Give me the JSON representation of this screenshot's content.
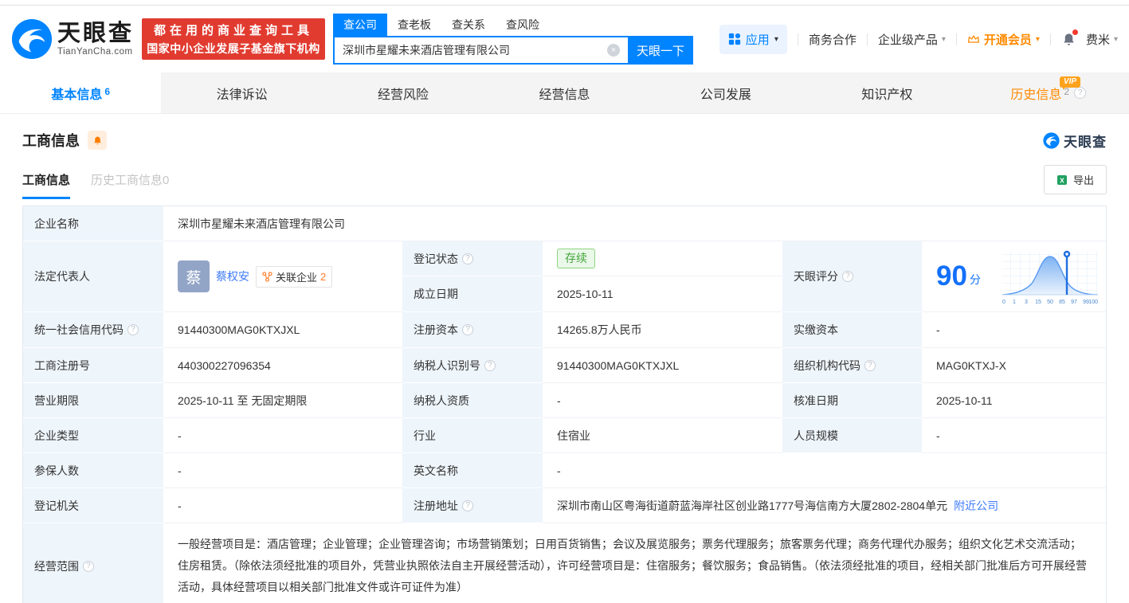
{
  "colors": {
    "brand_blue": "#0084ff",
    "link_blue": "#3e7bfa",
    "orange": "#ff8a00",
    "banner_red": "#e13b30",
    "status_green": "#44a53a",
    "score_blue": "#1370fa",
    "label_bg": "#eef5fb"
  },
  "icons": {
    "clear_glyph": "×",
    "help_glyph": "?",
    "caret_glyph": "▾",
    "excel_glyph": "X"
  },
  "header": {
    "logo_title": "天眼查",
    "logo_domain": "TianYanCha.com",
    "banner_line1": "都在用的商业查询工具",
    "banner_line2": "国家中小企业发展子基金旗下机构",
    "search_tabs": [
      {
        "label": "查公司"
      },
      {
        "label": "查老板"
      },
      {
        "label": "查关系"
      },
      {
        "label": "查风险"
      }
    ],
    "search_value": "深圳市星耀未来酒店管理有限公司",
    "search_button": "天眼一下",
    "nav_apps": "应用",
    "nav_cooperation": "商务合作",
    "nav_enterprise": "企业级产品",
    "nav_vip": "开通会员",
    "nav_user": "费米"
  },
  "nav_tabs": {
    "basic": {
      "label": "基本信息",
      "count": "6"
    },
    "legal": {
      "label": "法律诉讼"
    },
    "risk": {
      "label": "经营风险"
    },
    "operation": {
      "label": "经营信息"
    },
    "development": {
      "label": "公司发展"
    },
    "ip": {
      "label": "知识产权"
    },
    "history": {
      "label": "历史信息",
      "count": "2",
      "vip": "VIP"
    }
  },
  "section": {
    "title": "工商信息",
    "watermark": "天眼查",
    "subtab_active": "工商信息",
    "subtab_history": "历史工商信息0",
    "export": "导出"
  },
  "info": {
    "name": {
      "label": "企业名称",
      "value": "深圳市星耀未来酒店管理有限公司"
    },
    "legal": {
      "label": "法定代表人",
      "avatar": "蔡",
      "name": "蔡权安",
      "related": "关联企业",
      "related_count": "2"
    },
    "status": {
      "label": "登记状态",
      "value": "存续"
    },
    "established": {
      "label": "成立日期",
      "value": "2025-10-11"
    },
    "score": {
      "label": "天眼评分",
      "value": "90",
      "unit": "分",
      "ticks": [
        "0",
        "1",
        "3",
        "15",
        "50",
        "85",
        "97",
        "99",
        "100"
      ]
    },
    "uscc": {
      "label": "统一社会信用代码",
      "value": "91440300MAG0KTXJXL"
    },
    "reg_capital": {
      "label": "注册资本",
      "value": "14265.8万人民币"
    },
    "paid_capital": {
      "label": "实缴资本",
      "value": "-"
    },
    "reg_no": {
      "label": "工商注册号",
      "value": "440300227096354"
    },
    "tax_id": {
      "label": "纳税人识别号",
      "value": "91440300MAG0KTXJXL"
    },
    "org_code": {
      "label": "组织机构代码",
      "value": "MAG0KTXJ-X"
    },
    "term": {
      "label": "营业期限",
      "value": "2025-10-11 至 无固定期限"
    },
    "taxpayer": {
      "label": "纳税人资质",
      "value": "-"
    },
    "approval": {
      "label": "核准日期",
      "value": "2025-10-11"
    },
    "type": {
      "label": "企业类型",
      "value": "-"
    },
    "industry": {
      "label": "行业",
      "value": "住宿业"
    },
    "staff": {
      "label": "人员规模",
      "value": "-"
    },
    "insured": {
      "label": "参保人数",
      "value": "-"
    },
    "en_name": {
      "label": "英文名称",
      "value": "-"
    },
    "authority": {
      "label": "登记机关",
      "value": "-"
    },
    "address": {
      "label": "注册地址",
      "value": "深圳市南山区粤海街道蔚蓝海岸社区创业路1777号海信南方大厦2802-2804单元",
      "link": "附近公司"
    },
    "scope": {
      "label": "经营范围",
      "value": "一般经营项目是：酒店管理；企业管理；企业管理咨询；市场营销策划；日用百货销售；会议及展览服务；票务代理服务；旅客票务代理；商务代理代办服务；组织文化艺术交流活动；住房租赁。（除依法须经批准的项目外，凭营业执照依法自主开展经营活动），许可经营项目是：住宿服务；餐饮服务；食品销售。（依法须经批准的项目，经相关部门批准后方可开展经营活动，具体经营项目以相关部门批准文件或许可证件为准）"
    }
  },
  "chart_data": {
    "type": "area",
    "title": "天眼评分分布",
    "score": 90,
    "x_ticks": [
      0,
      1,
      3,
      15,
      50,
      85,
      97,
      99,
      100
    ],
    "marker_value": 90,
    "legend": "percentile bell curve with marker pin at company score"
  }
}
